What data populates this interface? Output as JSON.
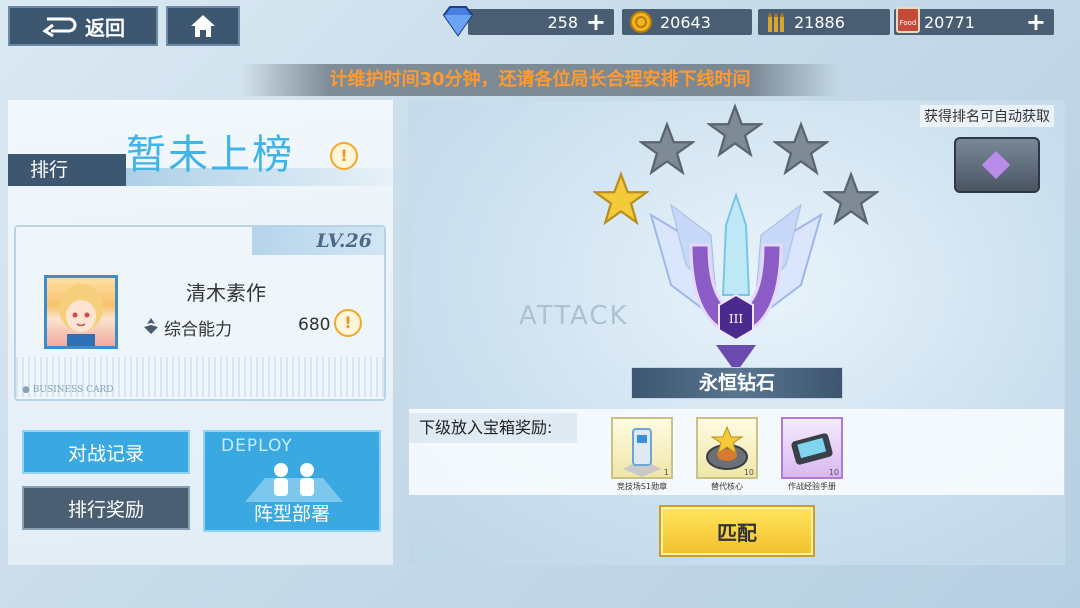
{
  "topbar": {
    "back_label": "返回",
    "diamond": "258",
    "coin": "20643",
    "bullet": "21886",
    "food": "20771",
    "food_icon_text": "Food"
  },
  "notice": "计维护时间30分钟，还请各位局长合理安排下线时间",
  "left": {
    "tab": "排行",
    "status": "暂未上榜",
    "card": {
      "level": "LV.26",
      "name": "清木素作",
      "power_label": "综合能力",
      "power_value": "680",
      "business": "● BUSINESS CARD"
    },
    "buttons": {
      "record": "对战记录",
      "reward": "排行奖励",
      "deploy_en": "DEPLOY",
      "deploy": "阵型部署"
    }
  },
  "right": {
    "attack_text": "ATTACK",
    "autoget": "获得排名可自动获取",
    "rank_name": "永恒钻石",
    "rank_numeral": "III",
    "stars_total": 5,
    "stars_filled": 1,
    "reward_label": "下级放入宝箱奖励:",
    "items": [
      {
        "name": "竞技场S1勋章",
        "count": "1"
      },
      {
        "name": "替代核心",
        "count": "10"
      },
      {
        "name": "作战经验手册",
        "count": "10"
      }
    ],
    "match": "匹配"
  },
  "colors": {
    "accent_blue": "#3aa9e2",
    "dark_slate": "#3e5770",
    "notice_orange": "#ff9a2e",
    "gold": "#f2c12e"
  }
}
